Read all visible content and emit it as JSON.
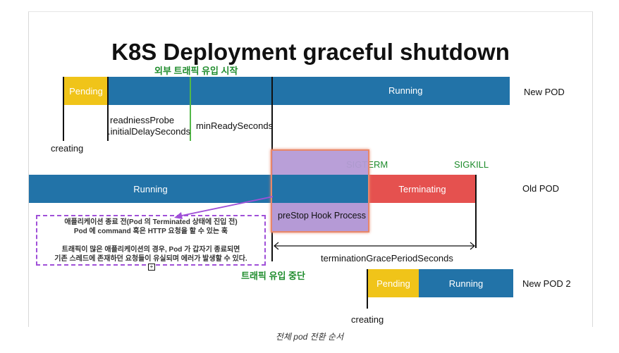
{
  "title": "K8S Deployment graceful shutdown",
  "labels": {
    "traffic_start": "외부 트래픽 유입 시작",
    "traffic_stop": "트래픽 유입 중단",
    "readiness_line1": "readniessProbe",
    "readiness_line2": ".initialDelaySeconds",
    "min_ready": "minReadySeconds",
    "creating_new": "creating",
    "creating_new2": "creating",
    "sigterm": "SIGTERM",
    "sigkill": "SIGKILL",
    "grace_period": "terminationGracePeriodSeconds",
    "prestop": "preStop Hook Process"
  },
  "bars": {
    "new_pending": "Pending",
    "new_running": "Running",
    "old_running": "Running",
    "old_terminating": "Terminating",
    "new2_pending": "Pending",
    "new2_running": "Running"
  },
  "rows": {
    "new_pod": "New POD",
    "old_pod": "Old POD",
    "new_pod2": "New POD 2"
  },
  "note": {
    "line1": "애플리케이션 종료 전(Pod 의 Terminated 상태에 진입 전)",
    "line2": "Pod 에 command 혹은 HTTP 요청을 할 수  있는 훅",
    "line3": "트래픽이 많은 애플리케이션의 경우, Pod 가 갑자기 종료되면",
    "line4": "기존 스레드에 존재하던 요청들이 유실되며 에러가 발생할 수 있다."
  },
  "caption": "전체 pod 전환 순서",
  "colors": {
    "running": "#2273a8",
    "pending": "#f0c419",
    "terminating": "#e5514f",
    "prestop": "#b59ad6",
    "highlight": "#e8876a",
    "annotation": "#a050d8",
    "green_text": "#1e8c2c"
  }
}
